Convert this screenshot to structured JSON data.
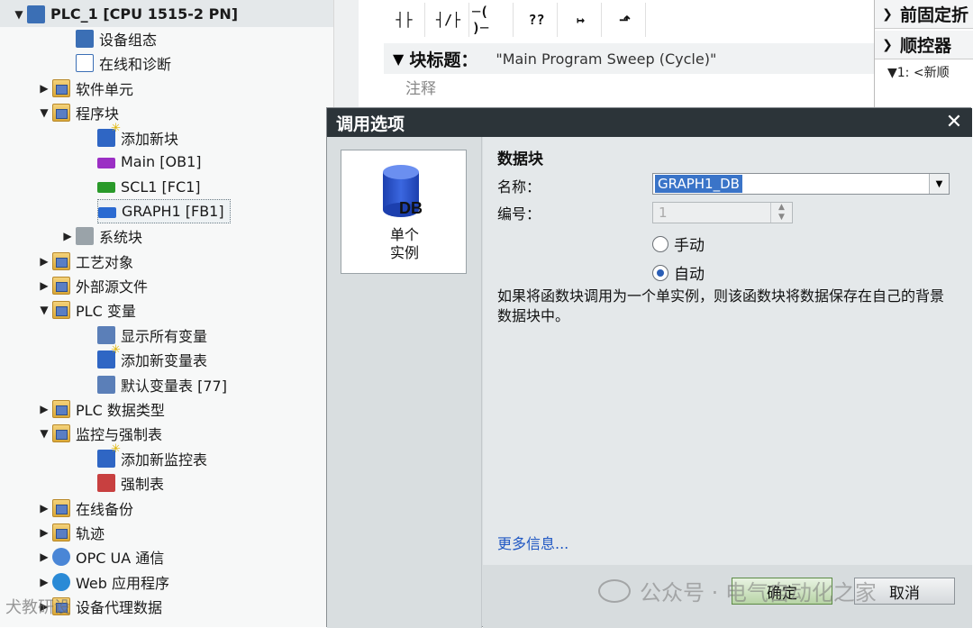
{
  "tree": {
    "items": [
      {
        "label": "PLC_1 [CPU 1515-2 PN]",
        "toggle": "▼",
        "icon": "cpu-icon",
        "level": 1
      },
      {
        "label": "设备组态",
        "toggle": "",
        "icon": "device-config-icon",
        "level": 3
      },
      {
        "label": "在线和诊断",
        "toggle": "",
        "icon": "online-diagnostics-icon",
        "level": 3
      },
      {
        "label": "软件单元",
        "toggle": "▶",
        "icon": "software-unit-icon",
        "level": 2
      },
      {
        "label": "程序块",
        "toggle": "▼",
        "icon": "program-blocks-icon",
        "level": 2
      },
      {
        "label": "添加新块",
        "toggle": "",
        "icon": "add-block-icon",
        "level": 4
      },
      {
        "label": "Main [OB1]",
        "toggle": "",
        "icon": "ob-block-icon",
        "level": 4
      },
      {
        "label": "SCL1 [FC1]",
        "toggle": "",
        "icon": "fc-block-icon",
        "level": 4
      },
      {
        "label": "GRAPH1 [FB1]",
        "toggle": "",
        "icon": "fb-block-icon",
        "level": 4
      },
      {
        "label": "系统块",
        "toggle": "▶",
        "icon": "system-blocks-icon",
        "level": 3
      },
      {
        "label": "工艺对象",
        "toggle": "▶",
        "icon": "technology-objects-icon",
        "level": 2
      },
      {
        "label": "外部源文件",
        "toggle": "▶",
        "icon": "external-source-icon",
        "level": 2
      },
      {
        "label": "PLC 变量",
        "toggle": "▼",
        "icon": "plc-tags-icon",
        "level": 2
      },
      {
        "label": "显示所有变量",
        "toggle": "",
        "icon": "show-all-tags-icon",
        "level": 4
      },
      {
        "label": "添加新变量表",
        "toggle": "",
        "icon": "add-tag-table-icon",
        "level": 4
      },
      {
        "label": "默认变量表 [77]",
        "toggle": "",
        "icon": "default-tag-table-icon",
        "level": 4
      },
      {
        "label": "PLC 数据类型",
        "toggle": "▶",
        "icon": "plc-data-types-icon",
        "level": 2
      },
      {
        "label": "监控与强制表",
        "toggle": "▼",
        "icon": "watch-force-tables-icon",
        "level": 2
      },
      {
        "label": "添加新监控表",
        "toggle": "",
        "icon": "add-watch-table-icon",
        "level": 4
      },
      {
        "label": "强制表",
        "toggle": "",
        "icon": "force-table-icon",
        "level": 4
      },
      {
        "label": "在线备份",
        "toggle": "▶",
        "icon": "online-backup-icon",
        "level": 2
      },
      {
        "label": "轨迹",
        "toggle": "▶",
        "icon": "traces-icon",
        "level": 2
      },
      {
        "label": "OPC UA 通信",
        "toggle": "▶",
        "icon": "opc-ua-icon",
        "level": 2
      },
      {
        "label": "Web 应用程序",
        "toggle": "▶",
        "icon": "web-app-icon",
        "level": 2
      },
      {
        "label": "设备代理数据",
        "toggle": "▶",
        "icon": "device-proxy-icon",
        "level": 2
      }
    ]
  },
  "editor": {
    "toolbar": [
      "┤├",
      "┤/├",
      "─( )─",
      "??",
      "↦",
      "⬏"
    ],
    "block_title_label": "块标题：",
    "block_title_value": "\"Main Program Sweep (Cycle)\"",
    "comment_placeholder": "注释"
  },
  "right_panel": {
    "row1": "前固定折",
    "row2": "顺控器",
    "sub": "▼1: <新顺"
  },
  "dialog": {
    "title": "调用选项",
    "instance_card": {
      "badge": "DB",
      "label_line1": "单个",
      "label_line2": "实例"
    },
    "section_title": "数据块",
    "name_label": "名称：",
    "name_value": "GRAPH1_DB",
    "number_label": "编号：",
    "number_value": "1",
    "radio_manual": "手动",
    "radio_auto": "自动",
    "selected_radio": "auto",
    "description": "如果将函数块调用为一个单实例，则该函数块将数据保存在自己的背景数据块中。",
    "more_info": "更多信息...",
    "ok": "确定",
    "cancel": "取消"
  },
  "watermark": {
    "main": "公众号 · 电气自动化之家",
    "corner": "犬教研设"
  },
  "colors": {
    "dialog_title_bg": "#2c3439",
    "accent": "#3a74c8",
    "ok_green": "#b8d4a6",
    "link": "#1f57c3"
  }
}
